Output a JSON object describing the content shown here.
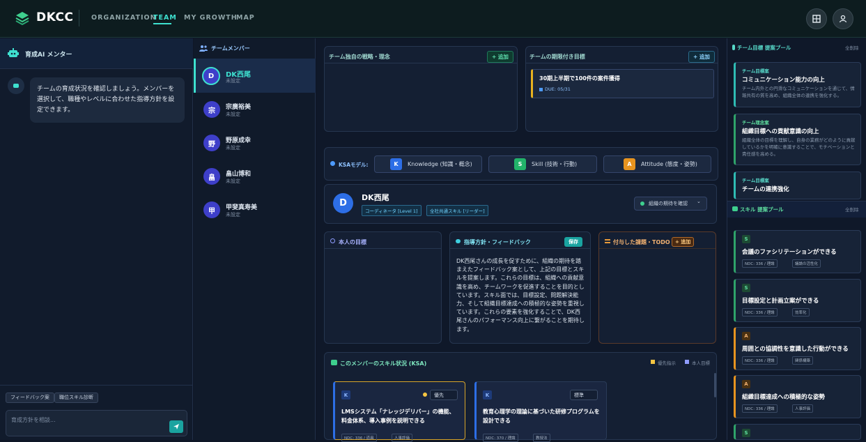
{
  "header": {
    "logo": "DKCC",
    "nav": [
      "ORGANIZATION",
      "TEAM",
      "MY GROWTH",
      "MAP"
    ],
    "active_nav": "TEAM",
    "accent": "#3ee0cf"
  },
  "mentor": {
    "title": "育成AI メンター",
    "message": "チームの育成状況を確認しましょう。メンバーを選択して、職種やレベルに合わせた指導方針を設定できます。",
    "btn_feedback": "フィードバック案",
    "btn_skill": "職位スキル診断",
    "input_placeholder": "育成方針を相談..."
  },
  "members": {
    "title": "チームメンバー",
    "items": [
      {
        "initial": "D",
        "name": "DK西尾",
        "status": "未設定"
      },
      {
        "initial": "宗",
        "name": "宗廣裕美",
        "status": "未設定"
      },
      {
        "initial": "野",
        "name": "野原成幸",
        "status": "未設定"
      },
      {
        "initial": "畠",
        "name": "畠山博和",
        "status": "未設定"
      },
      {
        "initial": "甲",
        "name": "甲斐真寿美",
        "status": "未設定"
      }
    ]
  },
  "main": {
    "strategy_title": "チーム独自の戦略・理念",
    "add": "+ 追加",
    "goals_title": "チームの期限付き目標",
    "goal_item": "30期上半期で100件の案件獲得",
    "goal_due": "DUE: 05/31",
    "ksa_label": "KSAモデル:",
    "ksa": [
      {
        "letter": "K",
        "text": "Knowledge (知識・概念)",
        "color": "#2d6ee6"
      },
      {
        "letter": "S",
        "text": "Skill (技術・行動)",
        "color": "#22b36a"
      },
      {
        "letter": "A",
        "text": "Attitude (態度・姿勢)",
        "color": "#e8941f"
      }
    ],
    "profile": {
      "initial": "D",
      "name": "DK西尾",
      "badge1": "コーディネータ [Level 1]",
      "badge2": "全社共通スキル [リーダー]",
      "expect_btn": "組織の期待を確認"
    },
    "own_goal_title": "本人の目標",
    "guide_title": "指導方針・フィードバック",
    "save": "保存",
    "guide_text": "DK西尾さんの成長を促すために、組織の期待を踏まえたフィードバック案として、上記の目標とスキルを提案します。これらの目標は、組織への貢献意識を高め、チームワークを促進することを目的としています。スキル面では、目標設定、問題解決能力、そして組織目標達成への積極的な姿勢を重視しています。これらの要素を強化することで、DK西尾さんのパフォーマンス向上に繋がることを期待します。",
    "todo_title": "付与した課題・TODO",
    "todo_add": "+ 追加",
    "skills_title": "このメンバーのスキル状況 (KSA)",
    "legend1": "優先指示",
    "legend2": "本人目標",
    "skill_cards": [
      {
        "tag": "K",
        "priority": "優先",
        "title": "LMSシステム「ナレッジデリバー」の機能、料金体系、導入事例を説明できる",
        "meta1": "NDC: 336 / 道具",
        "meta2": "人事評価"
      },
      {
        "tag": "K",
        "priority": "標準",
        "title": "教育心理学の理論に基づいた研修プログラムを設計できる",
        "meta1": "NDC: 370 / 理論",
        "meta2": "教授法"
      }
    ]
  },
  "right": {
    "goal_pool_title": "チーム目標 提案プール",
    "delete_all": "全削除",
    "goal_pool": [
      {
        "label": "チーム目標案",
        "title": "コミュニケーション能力の向上",
        "desc": "チーム内外との円滑なコミュニケーションを通じて、情報共有の質を高め、組織全体の連携を強化する。"
      },
      {
        "label": "チーム理念案",
        "title": "組織目標への貢献意識の向上",
        "desc": "組織全体の目標を理解し、自身の業務がどのように貢献しているかを明確に意識することで、モチベーションと責任感を高める。"
      },
      {
        "label": "チーム目標案",
        "title": "チームの連携強化",
        "desc": ""
      }
    ],
    "skill_pool_title": "スキル 提案プール",
    "skill_pool": [
      {
        "tag": "S",
        "title": "会議のファシリテーションができる",
        "meta1": "NDC: 336 / 理論",
        "meta2": "議論の活性化"
      },
      {
        "tag": "S",
        "title": "目標設定と計画立案ができる",
        "meta1": "NDC: 336 / 理論",
        "meta2": "効率化"
      },
      {
        "tag": "A",
        "title": "周囲との協調性を意識した行動ができる",
        "meta1": "NDC: 336 / 理論",
        "meta2": "関係構築"
      },
      {
        "tag": "A",
        "title": "組織目標達成への積極的な姿勢",
        "meta1": "NDC: 336 / 理論",
        "meta2": "人事評価"
      },
      {
        "tag": "S",
        "title": "",
        "meta1": "",
        "meta2": ""
      }
    ]
  }
}
